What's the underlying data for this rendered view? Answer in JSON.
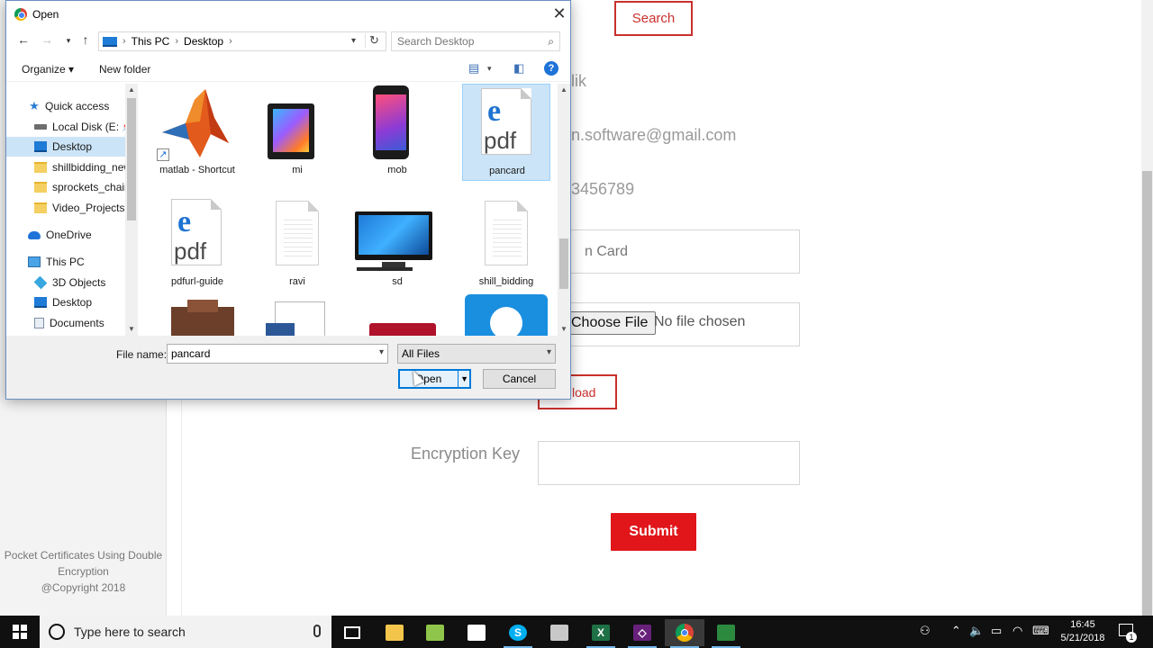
{
  "web": {
    "search_label": "Search",
    "name_fragment": "lik",
    "email_fragment": "n.software@gmail.com",
    "phone_fragment": "3456789",
    "doc_type_fragment": "n Card",
    "choose_file_label": "Choose File",
    "no_file_text": "No file chosen",
    "upload_fragment": "load",
    "encryption_label": "Encryption Key",
    "encryption_value": "",
    "submit_label": "Submit",
    "footer_line1": "Pocket Certificates Using Double",
    "footer_line2": "Encryption",
    "footer_line3": "@Copyright 2018"
  },
  "dialog": {
    "title": "Open",
    "breadcrumb": [
      "This PC",
      "Desktop"
    ],
    "search_placeholder": "Search Desktop",
    "toolbar": {
      "organize": "Organize",
      "new_folder": "New folder"
    },
    "nav": [
      {
        "label": "Quick access",
        "icon": "star",
        "indent": 1,
        "selected": false
      },
      {
        "label": "Local Disk (E:",
        "icon": "drive",
        "indent": 2,
        "selected": false,
        "pinned": true
      },
      {
        "label": "Desktop",
        "icon": "desktop",
        "indent": 2,
        "selected": true
      },
      {
        "label": "shillbidding_new",
        "icon": "folder",
        "indent": 2,
        "selected": false
      },
      {
        "label": "sprockets_chains",
        "icon": "folder",
        "indent": 2,
        "selected": false
      },
      {
        "label": "Video_Projects",
        "icon": "folder",
        "indent": 2,
        "selected": false
      },
      {
        "label": "OneDrive",
        "icon": "cloud",
        "indent": 1,
        "selected": false
      },
      {
        "label": "This PC",
        "icon": "pc",
        "indent": 1,
        "selected": false
      },
      {
        "label": "3D Objects",
        "icon": "cube",
        "indent": 2,
        "selected": false
      },
      {
        "label": "Desktop",
        "icon": "desktop",
        "indent": 2,
        "selected": false
      },
      {
        "label": "Documents",
        "icon": "doc",
        "indent": 2,
        "selected": false
      }
    ],
    "files": [
      {
        "label": "matlab - Shortcut",
        "type": "matlab",
        "selected": false
      },
      {
        "label": "mi",
        "type": "phone-mi",
        "selected": false
      },
      {
        "label": "mob",
        "type": "phone-mob",
        "selected": false
      },
      {
        "label": "pancard",
        "type": "pdf",
        "selected": true
      },
      {
        "label": "pdfurl-guide",
        "type": "pdf",
        "selected": false
      },
      {
        "label": "ravi",
        "type": "text",
        "selected": false
      },
      {
        "label": "sd",
        "type": "monitor",
        "selected": false
      },
      {
        "label": "shill_bidding",
        "type": "text",
        "selected": false
      }
    ],
    "pdf_icon_letter": "e",
    "pdf_icon_word": "pdf",
    "file_name_label": "File name:",
    "file_name_value": "pancard",
    "filter_value": "All Files",
    "open_label": "Open",
    "cancel_label": "Cancel"
  },
  "taskbar": {
    "search_placeholder": "Type here to search",
    "time": "16:45",
    "date": "5/21/2018",
    "notification_count": "1"
  },
  "colors": {
    "accent_red": "#e0161a",
    "outline_red": "#c9302c",
    "selection_blue": "#cce4f7",
    "windows_blue": "#0078d7"
  }
}
